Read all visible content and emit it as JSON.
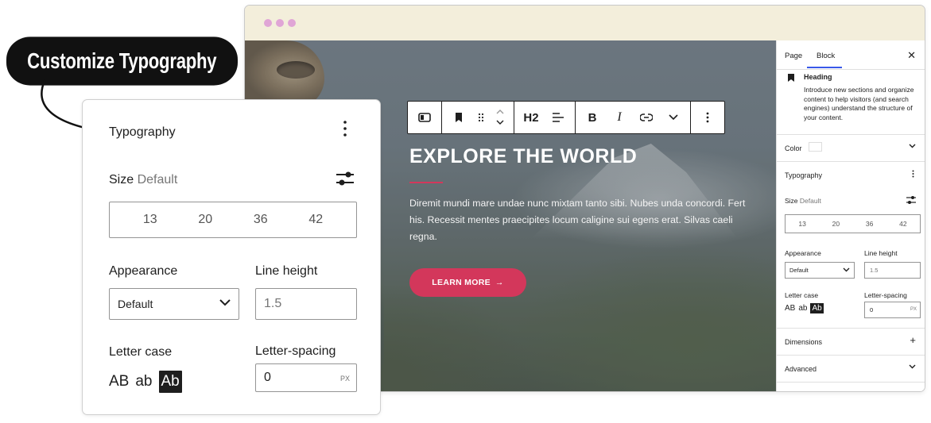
{
  "callout": {
    "text": "Customize Typography"
  },
  "browser": {
    "dot_color": "#e0a5d6",
    "toolbar": {
      "heading_level": "H2"
    },
    "hero": {
      "title": "EXPLORE THE WORLD",
      "body": "Diremit mundi mare undae nunc mixtam tanto sibi. Nubes unda concordi. Fert his. Recessit mentes praecipites locum caligine sui egens erat. Silvas caeli regna.",
      "button_label": "LEARN MORE",
      "button_arrow": "→",
      "accent_color": "#d3375b"
    },
    "sidebar": {
      "tabs": [
        {
          "label": "Page"
        },
        {
          "label": "Block"
        }
      ],
      "close_glyph": "✕",
      "block": {
        "title": "Heading",
        "description": "Introduce new sections and organize content to help visitors (and search engines) understand the structure of your content."
      },
      "color": {
        "label": "Color"
      },
      "typography": {
        "label": "Typography",
        "size_label": "Size",
        "size_value": "Default",
        "sizes": [
          "13",
          "20",
          "36",
          "42"
        ],
        "appearance_label": "Appearance",
        "appearance_value": "Default",
        "line_height_label": "Line height",
        "line_height_placeholder": "1.5",
        "letter_case_label": "Letter case",
        "letter_case_options": [
          "AB",
          "ab",
          "Ab"
        ],
        "letter_spacing_label": "Letter-spacing",
        "letter_spacing_value": "0",
        "letter_spacing_unit": "PX"
      },
      "dimensions": {
        "label": "Dimensions",
        "glyph": "+"
      },
      "advanced": {
        "label": "Advanced"
      }
    }
  },
  "panel": {
    "title": "Typography",
    "size_label": "Size",
    "size_value": "Default",
    "sizes": [
      "13",
      "20",
      "36",
      "42"
    ],
    "appearance_label": "Appearance",
    "appearance_value": "Default",
    "line_height_label": "Line height",
    "line_height_placeholder": "1.5",
    "letter_case_label": "Letter case",
    "letter_case_options": [
      "AB",
      "ab",
      "Ab"
    ],
    "letter_spacing_label": "Letter-spacing",
    "letter_spacing_value": "0",
    "letter_spacing_unit": "PX"
  }
}
